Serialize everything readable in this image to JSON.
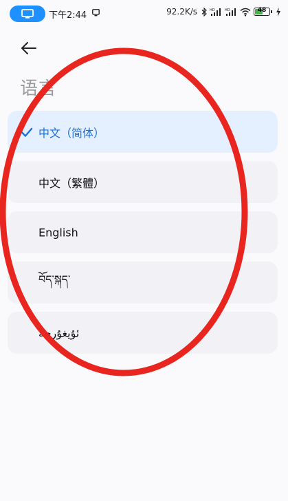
{
  "status_bar": {
    "time": "下午2:44",
    "network_speed": "92.2K/s",
    "signal_1_label": "HD",
    "signal_2_label": "HD",
    "battery_level": "48",
    "icons": [
      "screen-mirror-icon",
      "cast-icon",
      "bluetooth-icon",
      "signal-icon",
      "signal-icon",
      "wifi-icon",
      "battery-icon",
      "charging-icon"
    ]
  },
  "header": {
    "back_icon": "arrow-left-icon",
    "title": "语言"
  },
  "languages": [
    {
      "label": "中文（简体）",
      "selected": true
    },
    {
      "label": "中文（繁體）",
      "selected": false
    },
    {
      "label": "English",
      "selected": false
    },
    {
      "label": "བོད་སྐད་",
      "selected": false
    },
    {
      "label": "ئۇيغۇرچە",
      "selected": false
    }
  ],
  "colors": {
    "accent": "#1a6fd9",
    "selected_bg": "#e4efff",
    "item_bg": "#f1f1f6",
    "annotation": "#e8251e"
  }
}
